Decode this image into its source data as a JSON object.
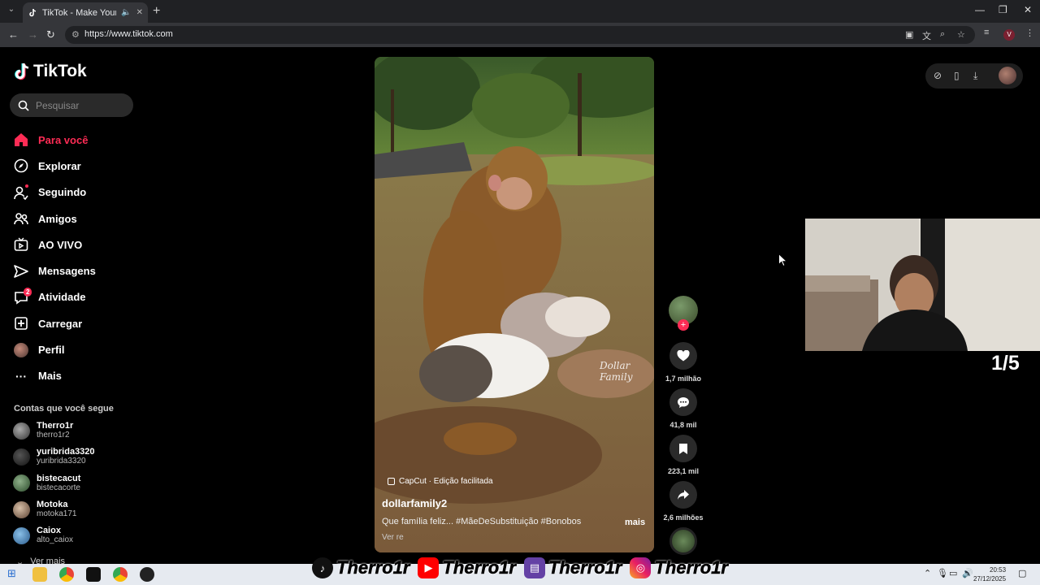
{
  "browser": {
    "tab_title": "TikTok - Make Your Day",
    "url": "https://www.tiktok.com"
  },
  "sidebar": {
    "logo": "TikTok",
    "search_placeholder": "Pesquisar",
    "items": [
      {
        "label": "Para você",
        "icon": "home-icon",
        "active": true
      },
      {
        "label": "Explorar",
        "icon": "compass-icon"
      },
      {
        "label": "Seguindo",
        "icon": "user-follow-icon"
      },
      {
        "label": "Amigos",
        "icon": "friends-icon"
      },
      {
        "label": "AO VIVO",
        "icon": "live-tv-icon"
      },
      {
        "label": "Mensagens",
        "icon": "send-icon"
      },
      {
        "label": "Atividade",
        "icon": "inbox-icon",
        "badge": "2"
      },
      {
        "label": "Carregar",
        "icon": "upload-icon"
      },
      {
        "label": "Perfil",
        "icon": "avatar"
      },
      {
        "label": "Mais",
        "icon": "more-icon"
      }
    ],
    "following_title": "Contas que você segue",
    "following": [
      {
        "name": "Therro1r",
        "handle": "therro1r2"
      },
      {
        "name": "yuribrida3320",
        "handle": "yuribrida3320"
      },
      {
        "name": "bistecacut",
        "handle": "bistecacorte"
      },
      {
        "name": "Motoka",
        "handle": "motoka171"
      },
      {
        "name": "Caiox",
        "handle": "alto_caiox"
      }
    ],
    "see_more": "Ver mais"
  },
  "video": {
    "author": "dollarfamily2",
    "capcut_label": "CapCut · Edição facilitada",
    "description": "Que família feliz... #MãeDeSubstituição #Bonobos",
    "more_label": "mais",
    "translate_label": "Ver re",
    "watermark": "Dollar Family",
    "likes": "1,7 milhão",
    "comments": "41,8 mil",
    "saves": "223,1 mil",
    "shares": "2,6 milhões"
  },
  "stream": {
    "counter": "1/5",
    "social_name_1": "Therro1r",
    "social_name_2": "Therro1r",
    "social_name_3": "Therro1r",
    "social_name_4": "Therro1r"
  },
  "taskbar": {
    "time": "20:53",
    "date": "27/12/2025"
  },
  "colors": {
    "accent": "#fe2c55",
    "background": "#000000",
    "panel": "#2a2a2a"
  }
}
